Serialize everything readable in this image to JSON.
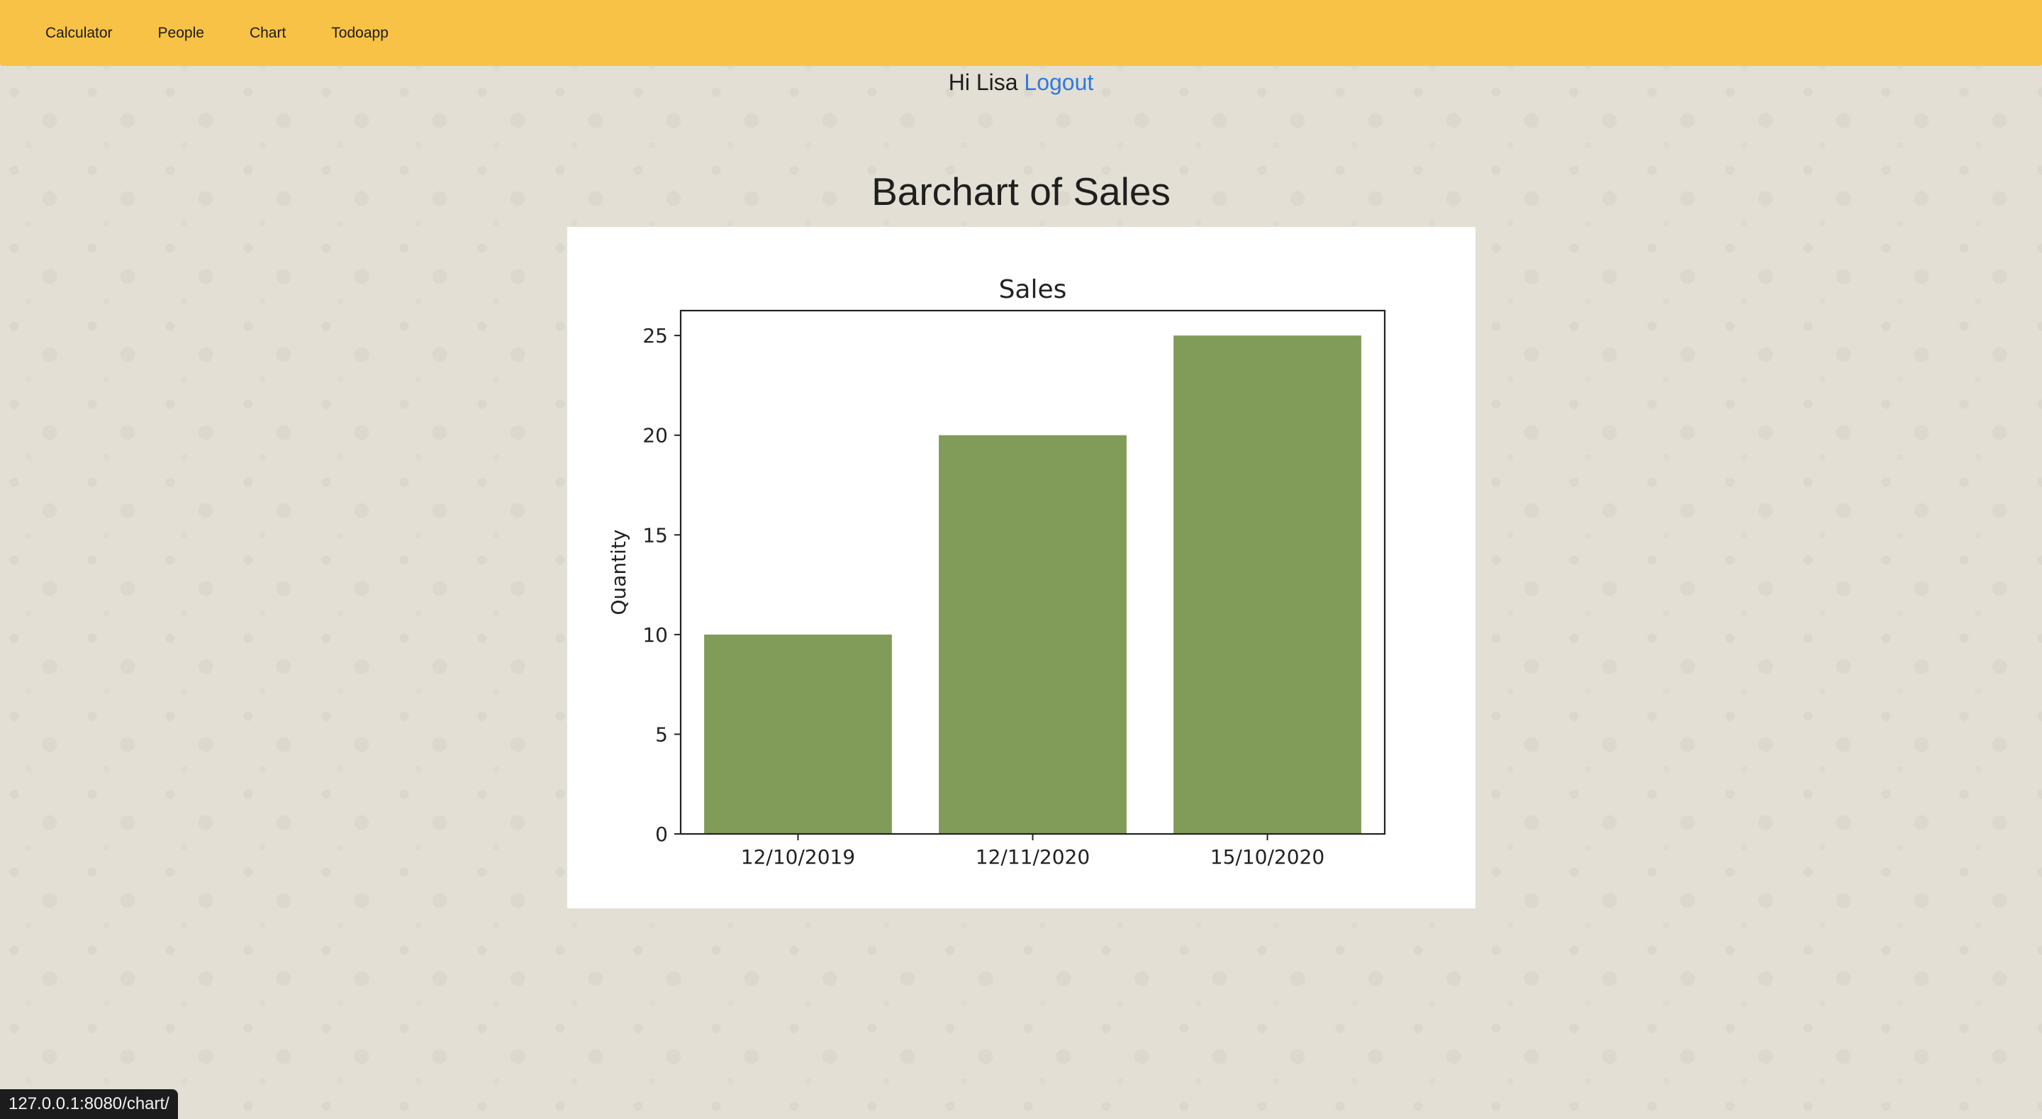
{
  "nav": {
    "items": [
      {
        "label": "Calculator"
      },
      {
        "label": "People"
      },
      {
        "label": "Chart"
      },
      {
        "label": "Todoapp"
      }
    ]
  },
  "header": {
    "greeting": "Hi Lisa",
    "logout_label": "Logout"
  },
  "page": {
    "title": "Barchart of Sales"
  },
  "status_bar": {
    "url": "127.0.0.1:8080/chart/"
  },
  "colors": {
    "navbar": "#f8c246",
    "bar": "#819c59",
    "link": "#2d7ae0"
  },
  "chart_data": {
    "type": "bar",
    "title": "Sales",
    "xlabel": "",
    "ylabel": "Quantity",
    "categories": [
      "12/10/2019",
      "12/11/2020",
      "15/10/2020"
    ],
    "values": [
      10,
      20,
      25
    ],
    "ylim": [
      0,
      26.25
    ],
    "yticks": [
      0,
      5,
      10,
      15,
      20,
      25
    ],
    "grid": false,
    "bar_color": "#819c59"
  }
}
